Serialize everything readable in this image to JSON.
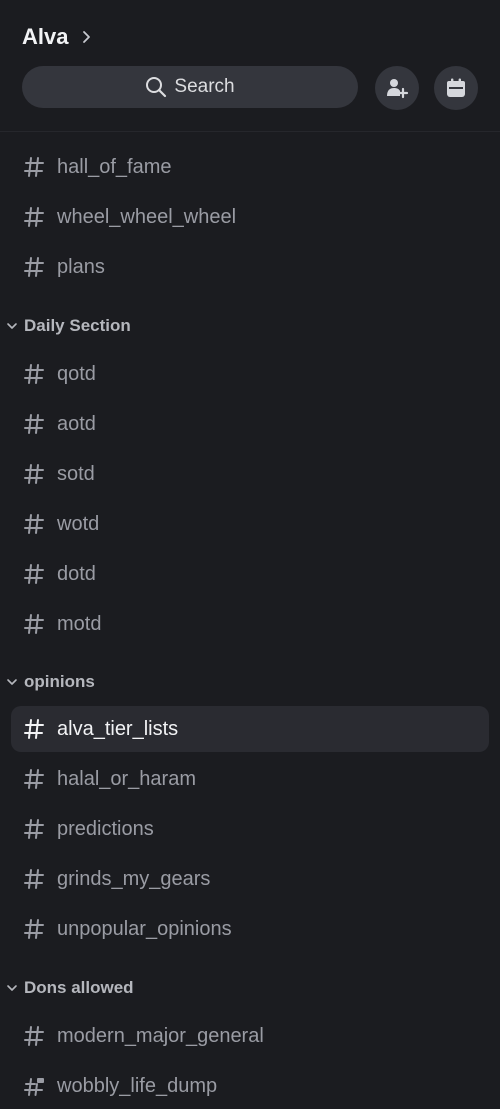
{
  "server": {
    "name": "Alva"
  },
  "search": {
    "label": "Search"
  },
  "actions": {
    "invite_icon": "add-member-icon",
    "events_icon": "calendar-icon"
  },
  "channels_top": [
    {
      "name": "hall_of_fame"
    },
    {
      "name": "wheel_wheel_wheel"
    },
    {
      "name": "plans"
    }
  ],
  "categories": [
    {
      "name": "Daily Section",
      "channels": [
        {
          "name": "qotd"
        },
        {
          "name": "aotd"
        },
        {
          "name": "sotd"
        },
        {
          "name": "wotd"
        },
        {
          "name": "dotd"
        },
        {
          "name": "motd"
        }
      ]
    },
    {
      "name": "opinions",
      "channels": [
        {
          "name": "alva_tier_lists",
          "selected": true
        },
        {
          "name": "halal_or_haram"
        },
        {
          "name": "predictions"
        },
        {
          "name": "grinds_my_gears"
        },
        {
          "name": "unpopular_opinions"
        }
      ]
    },
    {
      "name": "Dons allowed",
      "channels": [
        {
          "name": "modern_major_general"
        },
        {
          "name": "wobbly_life_dump"
        }
      ]
    }
  ],
  "colors": {
    "background": "#1b1c20",
    "selected": "#2a2b31",
    "button": "#34363d"
  }
}
